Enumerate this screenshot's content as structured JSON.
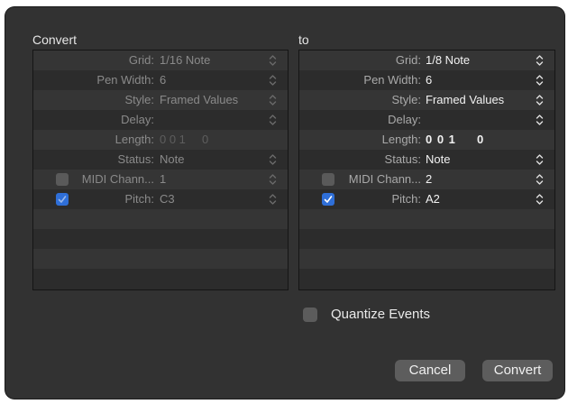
{
  "dialog": {
    "convert_title": "Convert",
    "to_title": "to",
    "quantize_label": "Quantize Events",
    "quantize_checked": false,
    "cancel_label": "Cancel",
    "convert_label": "Convert"
  },
  "left": {
    "grid_label": "Grid:",
    "grid_value": "1/16 Note",
    "pen_label": "Pen Width:",
    "pen_value": "6",
    "style_label": "Style:",
    "style_value": "Framed Values",
    "delay_label": "Delay:",
    "delay_value": "",
    "length_label": "Length:",
    "length_value": "0 0 1     0",
    "status_label": "Status:",
    "status_value": "Note",
    "midi_label": "MIDI Chann...",
    "midi_value": "1",
    "midi_checked": false,
    "pitch_label": "Pitch:",
    "pitch_value": "C3",
    "pitch_checked": true
  },
  "right": {
    "grid_label": "Grid:",
    "grid_value": "1/8 Note",
    "pen_label": "Pen Width:",
    "pen_value": "6",
    "style_label": "Style:",
    "style_value": "Framed Values",
    "delay_label": "Delay:",
    "delay_value": "",
    "length_label": "Length:",
    "length_value": "0 0 1     0",
    "status_label": "Status:",
    "status_value": "Note",
    "midi_label": "MIDI Chann...",
    "midi_value": "2",
    "midi_checked": false,
    "pitch_label": "Pitch:",
    "pitch_value": "A2",
    "pitch_checked": true
  },
  "icons": {
    "stepper": "up-down-chevron-icon",
    "checkmark": "checkmark-icon"
  }
}
